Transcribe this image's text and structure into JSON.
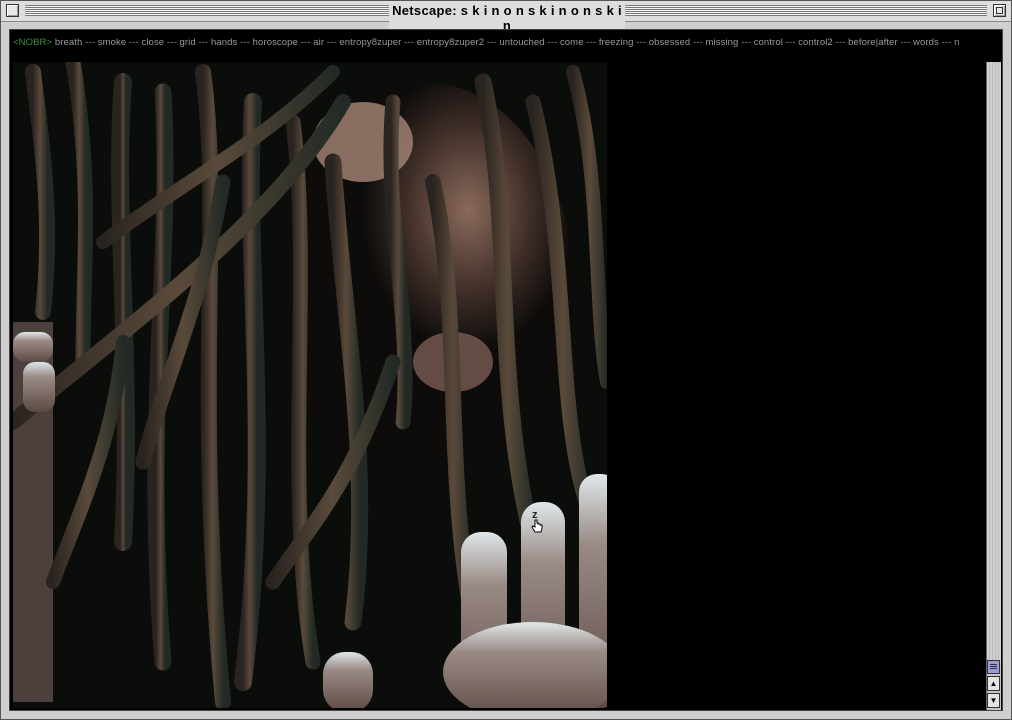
{
  "window": {
    "title": "Netscape: s k i n o n s k i n o n s k i n"
  },
  "nav": {
    "prefix": "<NOBR>",
    "separator": " --- ",
    "links": [
      "breath",
      "smoke",
      "close",
      "grid",
      "hands",
      "horoscope",
      "air",
      "entropy8zuper",
      "entropy8zuper2",
      "untouched",
      "come",
      "freezing",
      "obsessed",
      "missing",
      "control",
      "control2",
      "before|after",
      "words",
      "n"
    ]
  },
  "cursor": {
    "label": "z"
  },
  "photo": {
    "alt": "close-up of face covered by dreadlocks with hand"
  },
  "scroll": {
    "up_glyph": "▲",
    "down_glyph": "▼"
  },
  "colors": {
    "nobr": "#3f8f3f",
    "link": "#9a9a9a",
    "thumb": "#9b9bdb"
  }
}
